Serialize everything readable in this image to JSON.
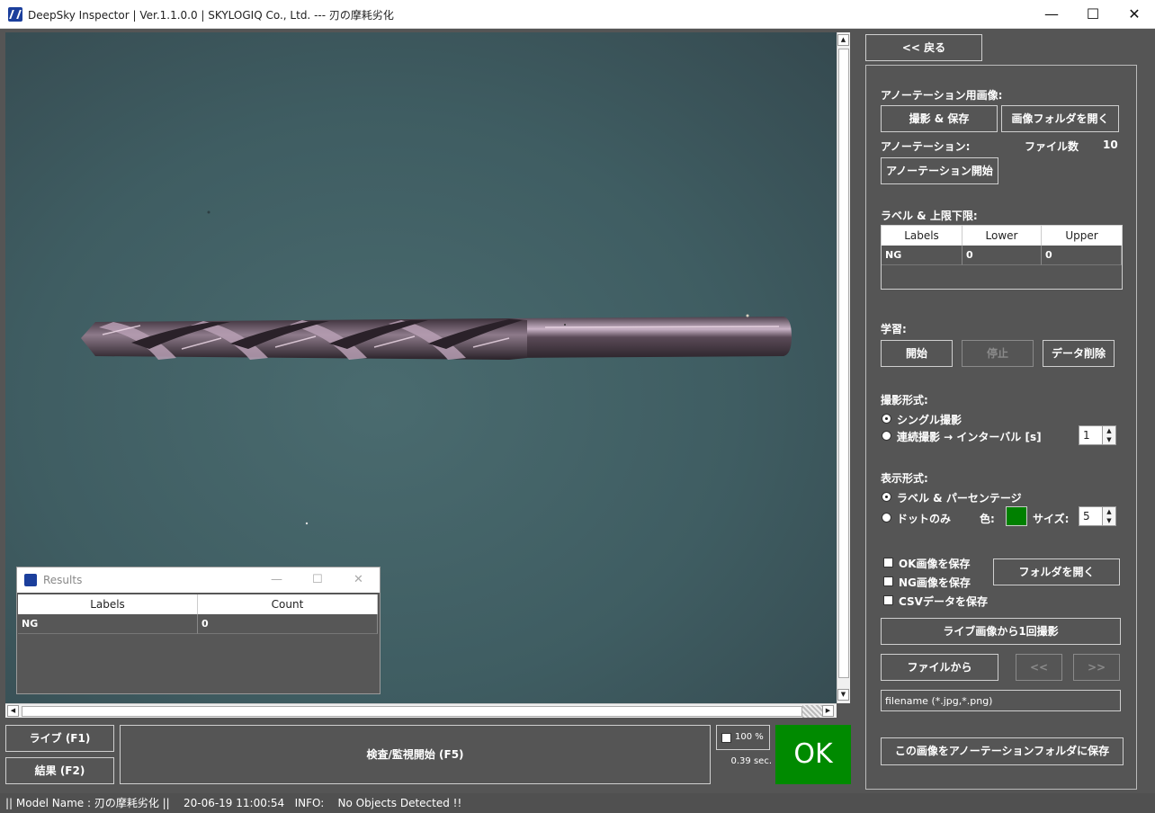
{
  "window": {
    "title": "DeepSky Inspector | Ver.1.1.0.0 | SKYLOGIQ Co., Ltd. --- 刃の摩耗劣化",
    "minimize_glyph": "—",
    "maximize_glyph": "☐",
    "close_glyph": "✕"
  },
  "results_window": {
    "title": "Results",
    "columns": [
      "Labels",
      "Count"
    ],
    "rows": [
      {
        "label": "NG",
        "count": "0"
      }
    ]
  },
  "bottom": {
    "live_button": "ライブ (F1)",
    "results_button": "結果 (F2)",
    "inspect_button": "検査/監視開始 (F5)",
    "zoom_checkbox_label": "100 %",
    "elapsed": "0.39 sec.",
    "judgement": "OK",
    "judgement_color": "#008a00"
  },
  "status_bar": {
    "text": "|| Model Name : 刃の摩耗劣化 ||    20-06-19 11:00:54   INFO:    No Objects Detected !!"
  },
  "right_panel": {
    "back_button": "<< 戻る",
    "annotation_image_label": "アノーテーション用画像:",
    "capture_save_button": "撮影 & 保存",
    "open_image_folder_button": "画像フォルダを開く",
    "annotation_label": "アノーテーション:",
    "file_count_label": "ファイル数",
    "file_count_value": "10",
    "start_annotation_button": "アノーテーション開始",
    "label_limits_label": "ラベル & 上限下限:",
    "limits_table": {
      "columns": [
        "Labels",
        "Lower",
        "Upper"
      ],
      "rows": [
        {
          "label": "NG",
          "lower": "0",
          "upper": "0"
        }
      ]
    },
    "learning_label": "学習:",
    "learn_start_button": "開始",
    "learn_stop_button": "停止",
    "delete_data_button": "データ削除",
    "capture_mode_label": "撮影形式:",
    "single_capture_option": "シングル撮影",
    "continuous_capture_option": "連続撮影 → インターバル [s]",
    "interval_value": "1",
    "display_mode_label": "表示形式:",
    "label_percentage_option": "ラベル & パーセンテージ",
    "dots_only_option": "ドットのみ",
    "color_label": "色:",
    "dot_color": "#008000",
    "size_label": "サイズ:",
    "size_value": "5",
    "save_ok_checkbox": "OK画像を保存",
    "save_ng_checkbox": "NG画像を保存",
    "save_csv_checkbox": "CSVデータを保存",
    "open_folder_button": "フォルダを開く",
    "capture_once_button": "ライブ画像から1回撮影",
    "from_file_button": "ファイルから",
    "prev_button": "<<",
    "next_button": ">>",
    "filename_placeholder": "filename (*.jpg,*.png)",
    "save_to_annotation_button": "この画像をアノーテーションフォルダに保存"
  }
}
